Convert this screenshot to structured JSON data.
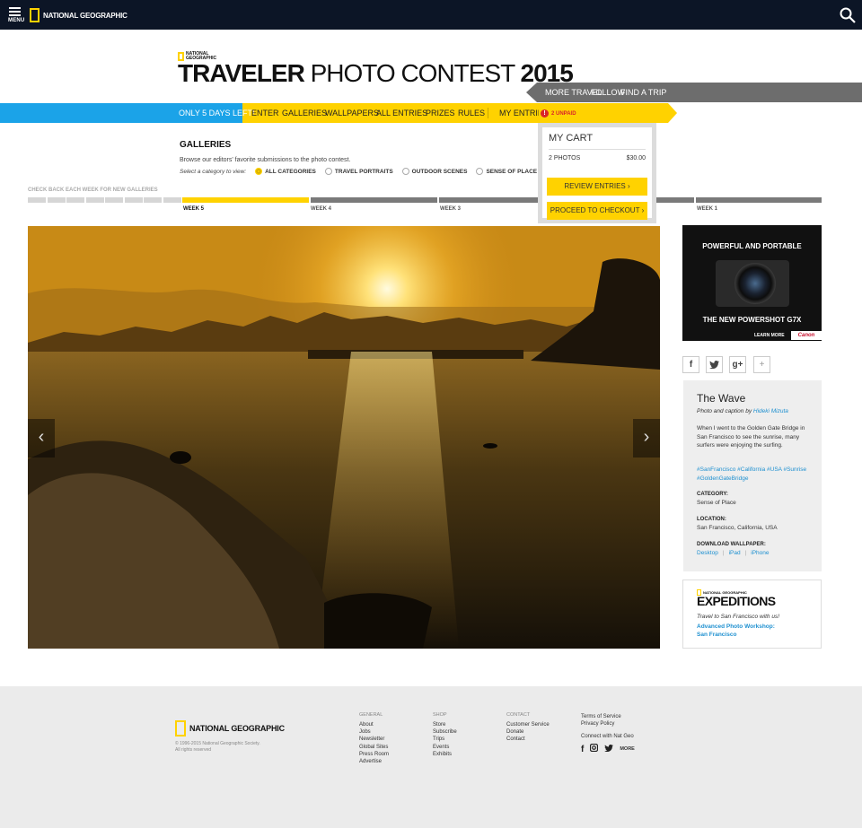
{
  "topbar": {
    "menu_label": "MENU",
    "logo_text": "NATIONAL GEOGRAPHIC"
  },
  "header": {
    "mini_logo_line1": "NATIONAL",
    "mini_logo_line2": "GEOGRAPHIC",
    "title_bold": "TRAVELER",
    "title_light": "PHOTO CONTEST",
    "title_year": "2015"
  },
  "subnav": {
    "items": [
      "MORE TRAVEL",
      "FOLLOW",
      "FIND A TRIP"
    ]
  },
  "nav": {
    "days_left": "ONLY 5 DAYS LEFT!",
    "items": [
      "ENTER",
      "GALLERIES",
      "WALLPAPERS",
      "ALL ENTRIES",
      "PRIZES",
      "RULES"
    ],
    "my_entries": "MY ENTRIES",
    "unpaid_count": "!",
    "unpaid_label": "2 UNPAID"
  },
  "cart": {
    "title": "MY CART",
    "photos": "2 PHOTOS",
    "price": "$30.00",
    "review_btn": "REVIEW ENTRIES",
    "checkout_btn": "PROCEED TO CHECKOUT"
  },
  "galleries": {
    "heading": "GALLERIES",
    "description": "Browse our editors' favorite submissions to the photo contest.",
    "prompt": "Select a category to view:",
    "categories": [
      {
        "label": "ALL CATEGORIES",
        "selected": true
      },
      {
        "label": "TRAVEL PORTRAITS",
        "selected": false
      },
      {
        "label": "OUTDOOR SCENES",
        "selected": false
      },
      {
        "label": "SENSE OF PLACE",
        "selected": false
      }
    ]
  },
  "weeks": {
    "check_back": "CHECK BACK EACH WEEK FOR NEW GALLERIES",
    "labels": [
      "WEEK 5",
      "WEEK 4",
      "WEEK 3",
      "WEEK 1"
    ],
    "selected": "WEEK 5"
  },
  "ad": {
    "headline": "POWERFUL AND PORTABLE",
    "product": "THE NEW POWERSHOT G7X",
    "cta": "LEARN MORE",
    "brand": "Canon"
  },
  "share": {
    "icons": [
      "facebook-icon",
      "twitter-icon",
      "google-plus-icon",
      "plus-icon"
    ]
  },
  "photo_info": {
    "title": "The Wave",
    "by_prefix": "Photo and caption by",
    "author": "Hideki Mizuta",
    "caption": "When I went to the Golden Gate Bridge in San Francisco to see the sunrise, many surfers were enjoying the surfing.",
    "tags": "#SanFrancisco #California #USA #Sunrise #GoldenGateBridge",
    "category_label": "CATEGORY:",
    "category_value": "Sense of Place",
    "location_label": "LOCATION:",
    "location_value": "San Francisco, California, USA",
    "download_label": "DOWNLOAD WALLPAPER:",
    "downloads": [
      "Desktop",
      "iPad",
      "iPhone"
    ]
  },
  "expeditions": {
    "mini_logo": "NATIONAL GEOGRAPHIC",
    "heading": "EXPEDITIONS",
    "tagline": "Travel to San Francisco with us!",
    "link_line1": "Advanced Photo Workshop:",
    "link_line2": "San Francisco"
  },
  "footer": {
    "logo_text": "NATIONAL GEOGRAPHIC",
    "copyright_line1": "© 1996-2015 National Geographic Society.",
    "copyright_line2": "All rights reserved",
    "columns": [
      {
        "heading": "GENERAL",
        "links": [
          "About",
          "Jobs",
          "Newsletter",
          "Global Sites",
          "Press Room",
          "Advertise"
        ]
      },
      {
        "heading": "SHOP",
        "links": [
          "Store",
          "Subscribe",
          "Trips",
          "Events",
          "Exhibits"
        ]
      },
      {
        "heading": "CONTACT",
        "links": [
          "Customer Service",
          "Donate",
          "Contact"
        ]
      },
      {
        "heading": "",
        "links": [
          "Terms of Service",
          "Privacy Policy",
          "",
          "Connect with Nat Geo"
        ]
      }
    ],
    "social_more": "MORE"
  },
  "colors": {
    "yellow": "#ffd200",
    "blue": "#1ba3e8",
    "topbar": "#0c1526",
    "link": "#1e90d0"
  }
}
